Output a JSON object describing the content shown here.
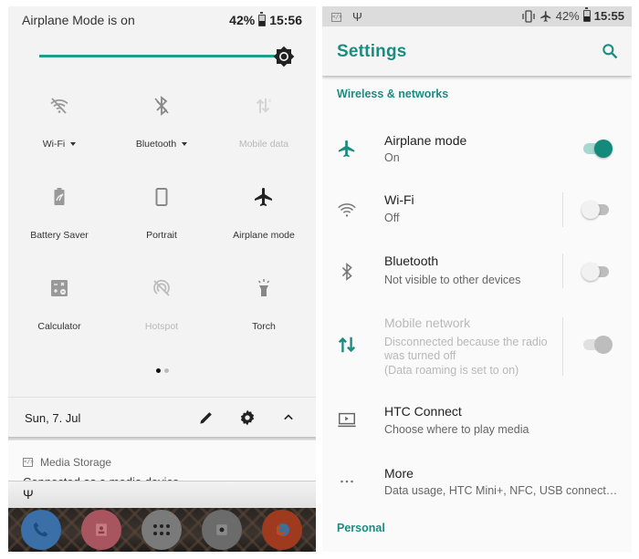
{
  "quick_settings": {
    "status_title": "Airplane Mode is on",
    "battery_percent": "42%",
    "time": "15:56",
    "brightness_level": 1.0,
    "tiles": [
      {
        "label": "Wi-Fi",
        "icon": "wifi-off-icon",
        "has_dropdown": true,
        "state": "off"
      },
      {
        "label": "Bluetooth",
        "icon": "bluetooth-off-icon",
        "has_dropdown": true,
        "state": "off"
      },
      {
        "label": "Mobile data",
        "icon": "mobile-data-icon",
        "has_dropdown": false,
        "state": "disabled"
      },
      {
        "label": "Battery Saver",
        "icon": "battery-saver-icon",
        "state": "off"
      },
      {
        "label": "Portrait",
        "icon": "portrait-icon",
        "state": "off"
      },
      {
        "label": "Airplane mode",
        "icon": "airplane-icon",
        "state": "on"
      },
      {
        "label": "Calculator",
        "icon": "calculator-icon",
        "state": "off"
      },
      {
        "label": "Hotspot",
        "icon": "hotspot-off-icon",
        "state": "disabled"
      },
      {
        "label": "Torch",
        "icon": "torch-icon",
        "state": "off"
      }
    ],
    "page_indicator": {
      "current": 1,
      "total": 2
    },
    "date": "Sun, 7. Jul",
    "notification": {
      "app": "Media Storage",
      "text": "Connected as a media device"
    },
    "dock_apps": [
      "Phone",
      "Contacts",
      "App drawer",
      "Camera",
      "Firefox"
    ]
  },
  "settings": {
    "status_bar": {
      "battery_percent": "42%",
      "time": "15:55"
    },
    "title": "Settings",
    "accent": "#1c8c80",
    "sections": [
      {
        "header": "Wireless & networks"
      },
      {
        "header": "Personal"
      }
    ],
    "items": [
      {
        "title": "Airplane mode",
        "summary": "On",
        "icon": "airplane-icon",
        "toggle": true,
        "enabled": true
      },
      {
        "title": "Wi-Fi",
        "summary": "Off",
        "icon": "wifi-icon",
        "toggle": false,
        "enabled": true
      },
      {
        "title": "Bluetooth",
        "summary": "Not visible to other devices",
        "icon": "bluetooth-icon",
        "toggle": false,
        "enabled": true
      },
      {
        "title": "Mobile network",
        "summary_lines": [
          "Disconnected because the radio",
          "was turned off",
          "(Data roaming is set to on)"
        ],
        "icon": "mobile-network-icon",
        "toggle": true,
        "enabled": false
      },
      {
        "title": "HTC Connect",
        "summary": "Choose where to play media",
        "icon": "cast-icon"
      },
      {
        "title": "More",
        "summary": "Data usage, HTC Mini+, NFC, USB connect…",
        "icon": "more-icon"
      }
    ]
  }
}
